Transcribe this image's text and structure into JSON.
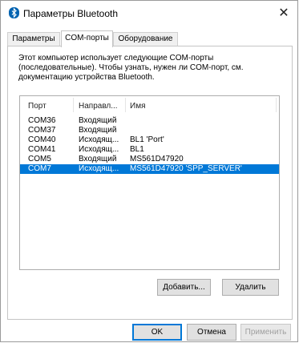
{
  "window": {
    "title": "Параметры Bluetooth",
    "close_glyph": "✕"
  },
  "tabs": [
    {
      "label": "Параметры",
      "active": false
    },
    {
      "label": "COM-порты",
      "active": true
    },
    {
      "label": "Оборудование",
      "active": false
    }
  ],
  "description": [
    "Этот компьютер использует следующие COM-порты",
    "(последовательные). Чтобы узнать, нужен ли COM-порт, см.",
    "документацию устройства Bluetooth."
  ],
  "list": {
    "headers": [
      "Порт",
      "Направл...",
      "Имя"
    ],
    "rows": [
      {
        "port": "COM36",
        "direction": "Входящий",
        "name": ""
      },
      {
        "port": "COM37",
        "direction": "Входящий",
        "name": ""
      },
      {
        "port": "COM40",
        "direction": "Исходящ...",
        "name": "BL1 'Port'"
      },
      {
        "port": "COM41",
        "direction": "Исходящ...",
        "name": "BL1"
      },
      {
        "port": "COM5",
        "direction": "Входящий",
        "name": "MS561D47920"
      },
      {
        "port": "COM7",
        "direction": "Исходящ...",
        "name": "MS561D47920 'SPP_SERVER'",
        "selected": true
      }
    ]
  },
  "buttons": {
    "add": "Добавить...",
    "remove": "Удалить",
    "ok": "OK",
    "cancel": "Отмена",
    "apply": "Применить"
  },
  "colors": {
    "accent": "#0078d7",
    "bluetooth_icon": "#0063b1"
  },
  "icons": {
    "app": "bluetooth-icon",
    "close": "close-icon"
  }
}
